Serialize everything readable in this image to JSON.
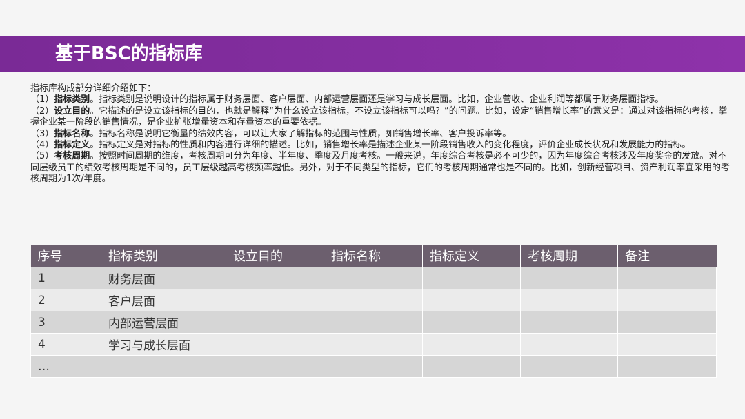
{
  "slide": {
    "title": "基于BSC的指标库"
  },
  "intro": {
    "lead": "指标库构成部分详细介绍如下：",
    "items": [
      {
        "num": "（1）",
        "term": "指标类别",
        "text": "。指标类别是说明设计的指标属于财务层面、客户层面、内部运营层面还是学习与成长层面。比如，企业营收、企业利润等都属于财务层面指标。"
      },
      {
        "num": "（2）",
        "term": "设立目的",
        "text": "。它描述的是设立该指标的目的，也就是解释“为什么设立该指标，不设立该指标可以吗？”的问题。比如，设定“销售增长率”的意义是：通过对该指标的考核，掌握企业某一阶段的销售情况，是企业扩张增量资本和存量资本的重要依据。"
      },
      {
        "num": "（3）",
        "term": "指标名称",
        "text": "。指标名称是说明它衡量的绩效内容，可以让大家了解指标的范围与性质，如销售增长率、客户投诉率等。"
      },
      {
        "num": "（4）",
        "term": "指标定义",
        "text": "。指标定义是对指标的性质和内容进行详细的描述。比如，销售增长率是描述企业某一阶段销售收入的变化程度，评价企业成长状况和发展能力的指标。"
      },
      {
        "num": "（5）",
        "term": "考核周期",
        "text": "。按照时间周期的维度，考核周期可分为年度、半年度、季度及月度考核。一般来说，年度综合考核是必不可少的，因为年度综合考核涉及年度奖金的发放。对不同层级员工的绩效考核周期是不同的，员工层级越高考核频率越低。另外，对于不同类型的指标，它们的考核周期通常也是不同的。比如，创新经营项目、资产利润率宜采用的考核周期为1次/年度。"
      }
    ]
  },
  "table": {
    "headers": [
      "序号",
      "指标类别",
      "设立目的",
      "指标名称",
      "指标定义",
      "考核周期",
      "备注"
    ],
    "rows": [
      [
        "1",
        "财务层面",
        "",
        "",
        "",
        "",
        ""
      ],
      [
        "2",
        "客户层面",
        "",
        "",
        "",
        "",
        ""
      ],
      [
        "3",
        "内部运营层面",
        "",
        "",
        "",
        "",
        ""
      ],
      [
        "4",
        "学习与成长层面",
        "",
        "",
        "",
        "",
        ""
      ],
      [
        "…",
        "",
        "",
        "",
        "",
        "",
        ""
      ]
    ]
  },
  "colors": {
    "title_bar": "#8e32aa",
    "table_header": "#6c5f6e"
  }
}
